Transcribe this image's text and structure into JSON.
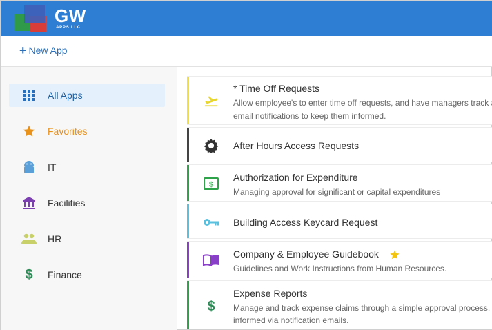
{
  "header": {
    "logo_text": "GW",
    "logo_subtext": "APPS LLC",
    "brand_color": "#2e7ed3"
  },
  "actions": {
    "new_app_plus": "+",
    "new_app_label": "New App"
  },
  "sidebar": {
    "items": [
      {
        "label": "All Apps",
        "icon": "grid-icon",
        "active": true
      },
      {
        "label": "Favorites",
        "icon": "star-icon",
        "color": "#e8911b"
      },
      {
        "label": "IT",
        "icon": "android-icon",
        "color": "#5a9fd8"
      },
      {
        "label": "Facilities",
        "icon": "bank-icon",
        "color": "#7b3fb0"
      },
      {
        "label": "HR",
        "icon": "people-icon",
        "color": "#c8d06a"
      },
      {
        "label": "Finance",
        "icon": "dollar-icon",
        "color": "#2e8b57"
      }
    ]
  },
  "apps": [
    {
      "title": "* Time Off Requests",
      "desc_line1": "Allow employee's to enter time off requests, and have managers track a",
      "desc_line2": "email notifications to keep them informed.",
      "icon": "airplane-takeoff-icon",
      "color": "#f5e03a"
    },
    {
      "title": "After Hours Access Requests",
      "icon": "gear-icon",
      "color": "#444444"
    },
    {
      "title": "Authorization for Expenditure",
      "desc_line1": "Managing approval for significant or capital expenditures",
      "icon": "money-bill-icon",
      "color": "#2fa34a"
    },
    {
      "title": "Building Access Keycard Request",
      "icon": "key-icon",
      "color": "#5bc0de"
    },
    {
      "title": "Company & Employee Guidebook",
      "desc_line1": "Guidelines and Work Instructions from Human Resources.",
      "icon": "book-icon",
      "color": "#8a3fc8",
      "favorite": true
    },
    {
      "title": "Expense Reports",
      "desc_line1": "Manage and track expense claims through a simple approval process.",
      "desc_line2": "informed via notification emails.",
      "icon": "dollar-icon",
      "color": "#2fa34a"
    }
  ]
}
